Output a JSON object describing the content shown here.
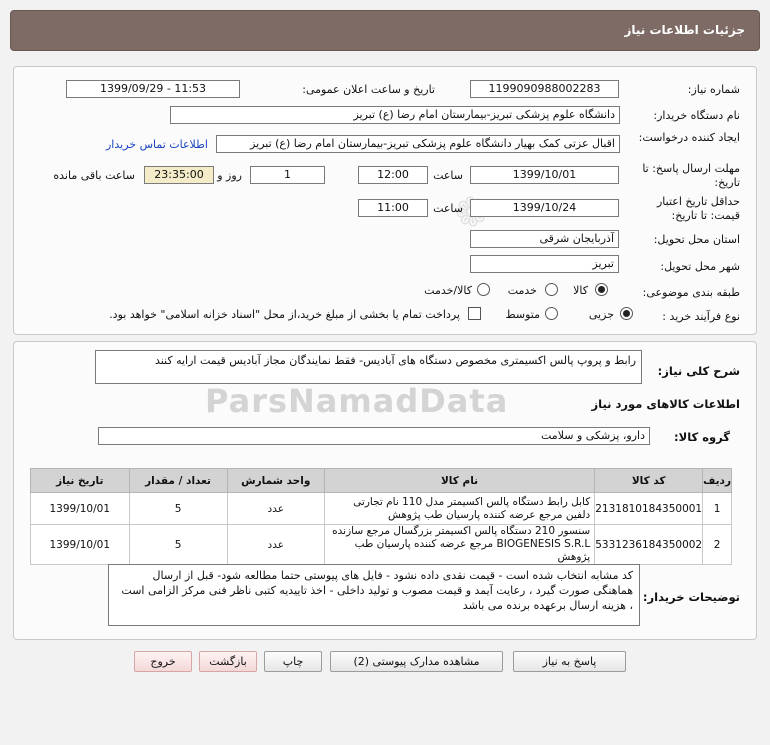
{
  "header": {
    "title": "جزئیات اطلاعات نیاز"
  },
  "form": {
    "need_number_label": "شماره نیاز:",
    "need_number": "1199090988002283",
    "announce_label": "تاریخ و ساعت اعلان عمومی:",
    "announce_value": "1399/09/29 - 11:53",
    "buyer_org_label": "نام دستگاه خریدار:",
    "buyer_org": "دانشگاه علوم پزشکی تبریز-بیمارستان امام رضا (ع) تبریز",
    "creator_label": "ایجاد کننده درخواست:",
    "creator": "اقبال عزتی کمک بهیار دانشگاه علوم پزشکی تبریز-بیمارستان امام رضا (ع) تبریز",
    "contact_link": "اطلاعات تماس خریدار",
    "deadline_label": "مهلت ارسال پاسخ: تا تاریخ:",
    "deadline_date": "1399/10/01",
    "time_label": "ساعت",
    "deadline_time": "12:00",
    "days": "1",
    "days_label": "روز و",
    "remaining": "23:35:00",
    "remaining_label": "ساعت باقی مانده",
    "validity_label": "حداقل تاریخ اعتبار قیمت: تا تاریخ:",
    "validity_date": "1399/10/24",
    "validity_time": "11:00",
    "province_label": "استان محل تحویل:",
    "province": "آذربایجان شرقی",
    "city_label": "شهر محل تحویل:",
    "city": "تبریز",
    "category_label": "طبقه بندی موضوعی:",
    "category_options": [
      "کالا",
      "خدمت",
      "کالا/خدمت"
    ],
    "process_label": "نوع فرآیند خرید :",
    "process_options": [
      "جزیی",
      "متوسط"
    ],
    "payment_note": "پرداخت تمام یا بخشی از مبلغ خرید،از محل \"اسناد خزانه اسلامی\" خواهد بود."
  },
  "details": {
    "description_label": "شرح کلی نیاز:",
    "description": "رابط و پروپ پالس اکسیمتری مخصوص دستگاه های آبادیس- فقط نمایندگان مجاز آبادیس قیمت ارایه کنند",
    "items_info_title": "اطلاعات کالاهای مورد نیاز",
    "group_label": "گروه کالا:",
    "group_value": "دارو، پزشکی و سلامت",
    "table_headers": [
      "ردیف",
      "کد کالا",
      "نام کالا",
      "واحد شمارش",
      "تعداد / مقدار",
      "تاریخ نیاز"
    ],
    "rows": [
      {
        "index": "1",
        "code": "2131810184350001",
        "name": "کابل رابط دستگاه پالس اکسیمتر مدل 110 نام تجارتی دلفین مرجع عرضه کننده پارسیان طب پژوهش",
        "unit": "عدد",
        "qty": "5",
        "date": "1399/10/01"
      },
      {
        "index": "2",
        "code": "5331236184350002",
        "name": "سنسور 210 دستگاه پالس اکسیمتر بزرگسال مرجع سازنده BIOGENESIS S.R.L مرجع عرضه کننده پارسیان طب پژوهش",
        "unit": "عدد",
        "qty": "5",
        "date": "1399/10/01"
      }
    ],
    "buyer_notes_label": "توضیحات خریدار:",
    "buyer_notes": "کد مشابه انتخاب شده است - قیمت نقدی داده نشود - فایل های پیوستی حتما مطالعه شود- قبل از ارسال هماهنگی صورت گیرد ، رعایت آیمد و قیمت مصوب و تولید داخلی -  اخذ تاییدیه کتبی ناظر فنی مرکز الزامی است ، هزینه ارسال برعهده برنده می باشد"
  },
  "buttons": {
    "reply": "پاسخ به نیاز",
    "attachments": "مشاهده مدارک پیوستی (2)",
    "print": "چاپ",
    "back": "بازگشت",
    "exit": "خروج"
  }
}
